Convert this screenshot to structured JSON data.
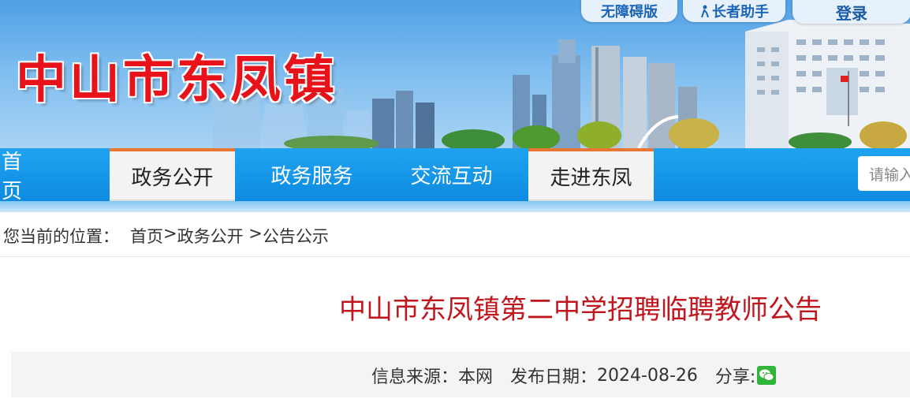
{
  "header": {
    "site_name": "中山市东凤镇",
    "accessibility": "无障碍版",
    "elder_mode": "长者助手",
    "login": "登录"
  },
  "nav": {
    "items": [
      "首　页",
      "政务公开",
      "政务服务",
      "交流互动",
      "走进东凤"
    ],
    "search_placeholder": "请输入"
  },
  "breadcrumb": {
    "prefix": "您当前的位置：",
    "home": "首页",
    "sep1": ">",
    "level1": "政务公开",
    "sep2": " >",
    "level2": "公告公示"
  },
  "article": {
    "title": "中山市东凤镇第二中学招聘临聘教师公告",
    "source_label": "信息来源：",
    "source": "本网",
    "date_label": "发布日期：",
    "date": "2024-08-26",
    "share_label": "分享:"
  },
  "colors": {
    "brand_red": "#e8121b",
    "nav_blue": "#0e8be0",
    "active_accent": "#e97733",
    "title_red": "#c0171f"
  }
}
